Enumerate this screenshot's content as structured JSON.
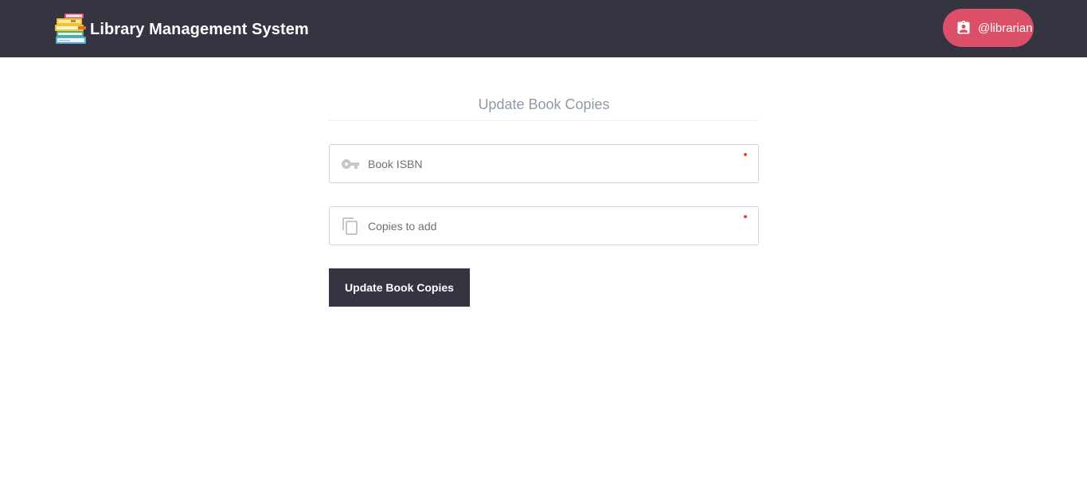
{
  "navbar": {
    "brand_title": "Library Management System",
    "logo_icon": "stacked-books-icon",
    "user_label": "@librarian",
    "user_icon": "contact-badge-icon",
    "colors": {
      "background": "#343541",
      "user_pill": "#db4f69"
    }
  },
  "form": {
    "title": "Update Book Copies",
    "fields": [
      {
        "placeholder": "Book ISBN",
        "icon": "key-icon",
        "required": true
      },
      {
        "placeholder": "Copies to add",
        "icon": "copy-icon",
        "required": true
      }
    ],
    "submit_label": "Update Book Copies",
    "colors": {
      "button": "#343541",
      "required_marker": "#e5473b"
    }
  }
}
